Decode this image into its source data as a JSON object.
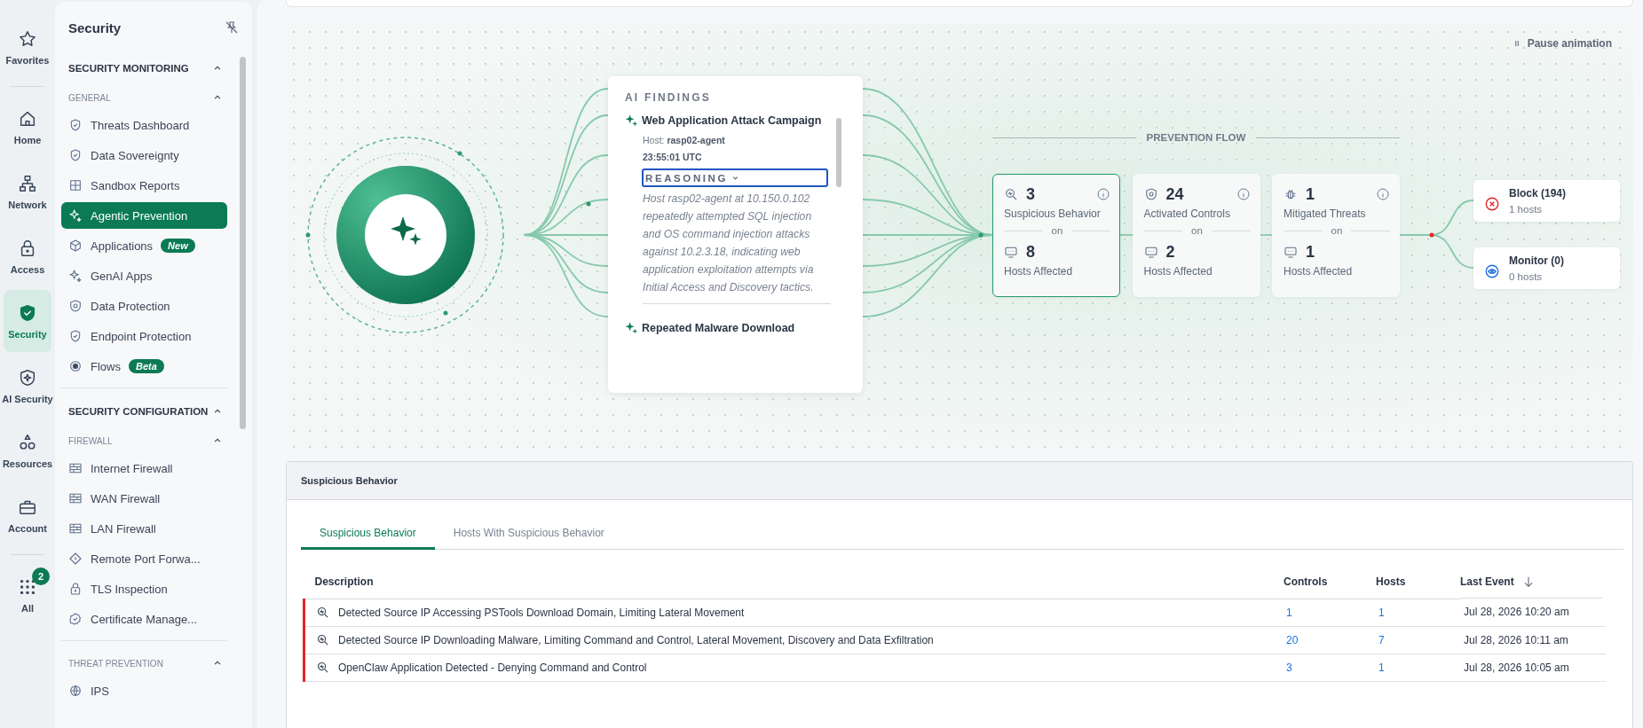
{
  "rail": {
    "groups": [
      [
        {
          "label": "Favorites",
          "selected": false
        }
      ],
      [
        {
          "label": "Home",
          "selected": false
        },
        {
          "label": "Network",
          "selected": false
        },
        {
          "label": "Access",
          "selected": false
        },
        {
          "label": "Security",
          "selected": true
        },
        {
          "label": "AI Security",
          "selected": false
        },
        {
          "label": "Resources",
          "selected": false
        },
        {
          "label": "Account",
          "selected": false
        }
      ],
      [
        {
          "label": "All",
          "selected": false,
          "badge": "2"
        }
      ]
    ]
  },
  "sidebar": {
    "title": "Security",
    "sections": [
      {
        "title": "SECURITY MONITORING",
        "expanded": true,
        "groups": [
          {
            "title": "GENERAL",
            "expanded": true,
            "items": [
              {
                "label": "Threats Dashboard",
                "selected": false
              },
              {
                "label": "Data Sovereignty",
                "selected": false
              },
              {
                "label": "Sandbox Reports",
                "selected": false
              },
              {
                "label": "Agentic Prevention",
                "selected": true
              },
              {
                "label": "Applications",
                "selected": false,
                "badge": "New"
              },
              {
                "label": "GenAI Apps",
                "selected": false
              },
              {
                "label": "Data Protection",
                "selected": false
              },
              {
                "label": "Endpoint Protection",
                "selected": false
              },
              {
                "label": "Flows",
                "selected": false,
                "badge": "Beta"
              }
            ]
          }
        ]
      },
      {
        "title": "SECURITY CONFIGURATION",
        "expanded": true,
        "groups": [
          {
            "title": "FIREWALL",
            "expanded": true,
            "items": [
              {
                "label": "Internet Firewall",
                "selected": false
              },
              {
                "label": "WAN Firewall",
                "selected": false
              },
              {
                "label": "LAN Firewall",
                "selected": false
              },
              {
                "label": "Remote Port Forwa...",
                "selected": false
              },
              {
                "label": "TLS Inspection",
                "selected": false
              },
              {
                "label": "Certificate Manage...",
                "selected": false
              }
            ]
          },
          {
            "title": "THREAT PREVENTION",
            "expanded": true,
            "items": [
              {
                "label": "IPS",
                "selected": false
              }
            ]
          }
        ]
      }
    ]
  },
  "canvas": {
    "pause_button": "Pause animation",
    "ai_findings": {
      "title": "AI FINDINGS",
      "findings": [
        {
          "title": "Web Application Attack Campaign",
          "host": "Host: **rasp02-agent**",
          "time": "23:55:01 UTC",
          "reasoning_label": "REASONING",
          "expanded": true,
          "reasoning": "Host rasp02-agent at 10.150.0.102 repeatedly attempted SQL injection and OS command injection attacks against 10.2.3.18, indicating web application exploitation attempts via Initial Access and Discovery tactics."
        },
        {
          "title": "Repeated Malware Download"
        }
      ]
    },
    "prevention_flow": {
      "title": "PREVENTION FLOW",
      "stages": [
        {
          "count": "3",
          "label": "Suspicious Behavior",
          "joiner": "on",
          "hosts_count": "8",
          "hosts_label": "Hosts Affected",
          "selected": true
        },
        {
          "count": "24",
          "label": "Activated Controls",
          "joiner": "on",
          "hosts_count": "2",
          "hosts_label": "Hosts Affected",
          "selected": false
        },
        {
          "count": "1",
          "label": "Mitigated Threats",
          "joiner": "on",
          "hosts_count": "1",
          "hosts_label": "Hosts Affected",
          "selected": false
        }
      ],
      "outcomes": [
        {
          "kind": "block",
          "title": "Block (194)",
          "subtitle": "1 hosts"
        },
        {
          "kind": "monitor",
          "title": "Monitor (0)",
          "subtitle": "0 hosts"
        }
      ]
    }
  },
  "details": {
    "title": "Suspicious Behavior",
    "tabs": [
      {
        "label": "Suspicious Behavior",
        "selected": true
      },
      {
        "label": "Hosts With Suspicious Behavior",
        "selected": false
      }
    ],
    "table": {
      "columns": [
        "Description",
        "Controls",
        "Hosts",
        "Last Event"
      ],
      "rows": [
        {
          "description": "Detected Source IP Accessing PSTools Download Domain, Limiting Lateral Movement",
          "controls": "1",
          "hosts": "1",
          "last_event": "Jul 28, 2026 10:20 am"
        },
        {
          "description": "Detected Source IP Downloading Malware, Limiting Command and Control, Lateral Movement, Discovery and Data Exfiltration",
          "controls": "20",
          "hosts": "7",
          "last_event": "Jul 28, 2026 10:11 am"
        },
        {
          "description": "OpenClaw Application Detected - Denying Command and Control",
          "controls": "3",
          "hosts": "1",
          "last_event": "Jul 28, 2026 10:05 am"
        }
      ]
    }
  }
}
